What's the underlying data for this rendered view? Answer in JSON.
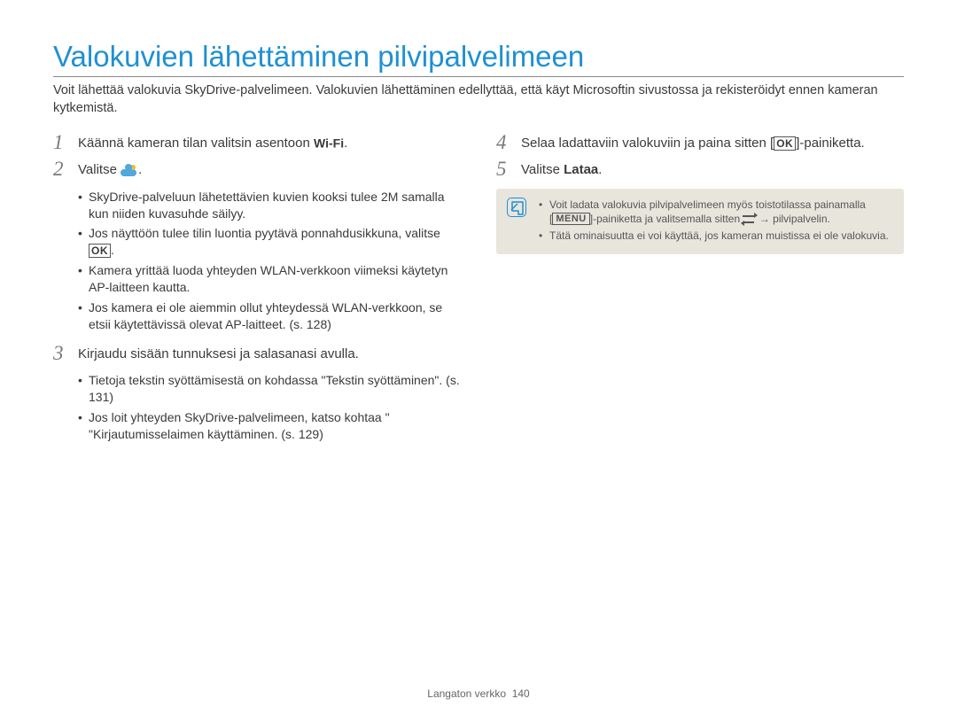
{
  "title": "Valokuvien lähettäminen pilvipalvelimeen",
  "intro": "Voit lähettää valokuvia SkyDrive-palvelimeen. Valokuvien lähettäminen edellyttää, että käyt Microsoftin sivustossa ja rekisteröidyt ennen kameran kytkemistä.",
  "left": {
    "step1_pre": "Käännä kameran tilan valitsin asentoon ",
    "step1_post": ".",
    "step2": "Valitse ",
    "step2_post": ".",
    "bullets2": [
      "SkyDrive-palveluun lähetettävien kuvien kooksi tulee 2M samalla kun niiden kuvasuhde säilyy.",
      "Jos näyttöön tulee tilin luontia pyytävä ponnahdusikkuna, valitse ",
      "Kamera yrittää luoda yhteyden WLAN-verkkoon viimeksi käytetyn AP-laitteen kautta.",
      "Jos kamera ei ole aiemmin ollut yhteydessä WLAN-verkkoon, se etsii käytettävissä olevat AP-laitteet. (s. 128)"
    ],
    "step3": "Kirjaudu sisään tunnuksesi ja salasanasi avulla.",
    "bullets3": [
      "Tietoja tekstin syöttämisestä on kohdassa \"Tekstin syöttäminen\". (s. 131)",
      "Jos loit yhteyden SkyDrive-palvelimeen, katso kohtaa \" \"Kirjautumisselaimen käyttäminen. (s. 129)"
    ]
  },
  "right": {
    "step4_pre": "Selaa ladattaviin valokuviin ja paina sitten [",
    "step4_post": "]-painiketta.",
    "step5_pre": "Valitse ",
    "step5_bold": "Lataa",
    "step5_post": ".",
    "note1_a": "Voit ladata valokuvia pilvipalvelimeen myös toistotilassa painamalla [",
    "note1_b": "]-painiketta ja valitsemalla sitten ",
    "note1_c": " → pilvipalvelin.",
    "note2": "Tätä ominaisuutta ei voi käyttää, jos kameran muistissa ei ole valokuvia."
  },
  "labels": {
    "wifi": "Wi-Fi",
    "ok": "OK",
    "menu": "MENU"
  },
  "footer_section": "Langaton verkko",
  "footer_page": "140"
}
